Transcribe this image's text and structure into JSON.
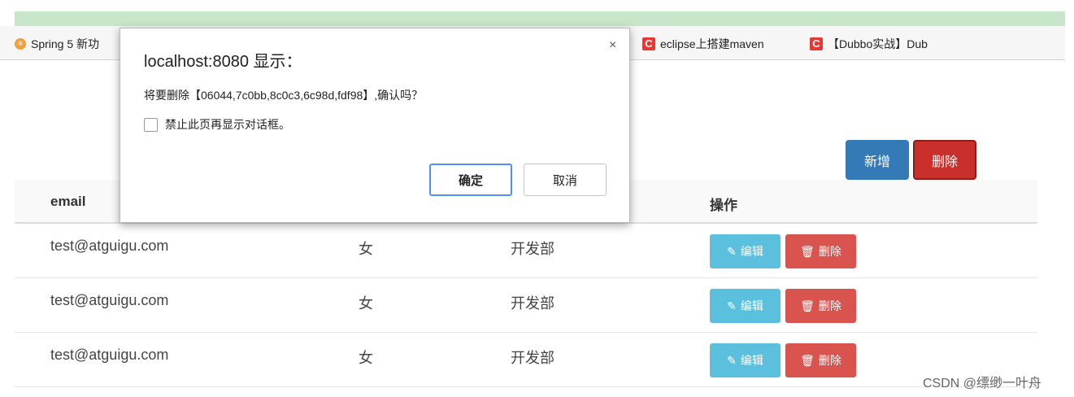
{
  "browser": {
    "bookmarks": [
      {
        "label": "Spring 5 新功",
        "icon": "spring-icon"
      },
      {
        "label": "eclipse上搭建maven",
        "icon": "csdn-c-icon"
      },
      {
        "label": "【Dubbo实战】Dub",
        "icon": "csdn-c-icon"
      }
    ]
  },
  "toolbar": {
    "add_label": "新增",
    "delete_label": "删除"
  },
  "table": {
    "headers": [
      "email",
      "操作"
    ],
    "rows": [
      {
        "email": "test@atguigu.com",
        "gender": "女",
        "dept": "开发部",
        "edit": "编辑",
        "delete": "删除"
      },
      {
        "email": "test@atguigu.com",
        "gender": "女",
        "dept": "开发部",
        "edit": "编辑",
        "delete": "删除"
      },
      {
        "email": "test@atguigu.com",
        "gender": "女",
        "dept": "开发部",
        "edit": "编辑",
        "delete": "删除"
      }
    ]
  },
  "dialog": {
    "title": "localhost:8080 显示：",
    "close": "×",
    "message": "将要删除【06044,7c0bb,8c0c3,6c98d,fdf98】,确认吗？",
    "checkbox_label": "禁止此页再显示对话框。",
    "ok_label": "确定",
    "cancel_label": "取消"
  },
  "icons": {
    "edit": "pencil-icon",
    "delete": "trash-icon"
  },
  "colors": {
    "primary": "#337ab7",
    "danger": "#d9534f",
    "info": "#5bc0de"
  },
  "watermark": "CSDN @缥缈一叶舟"
}
